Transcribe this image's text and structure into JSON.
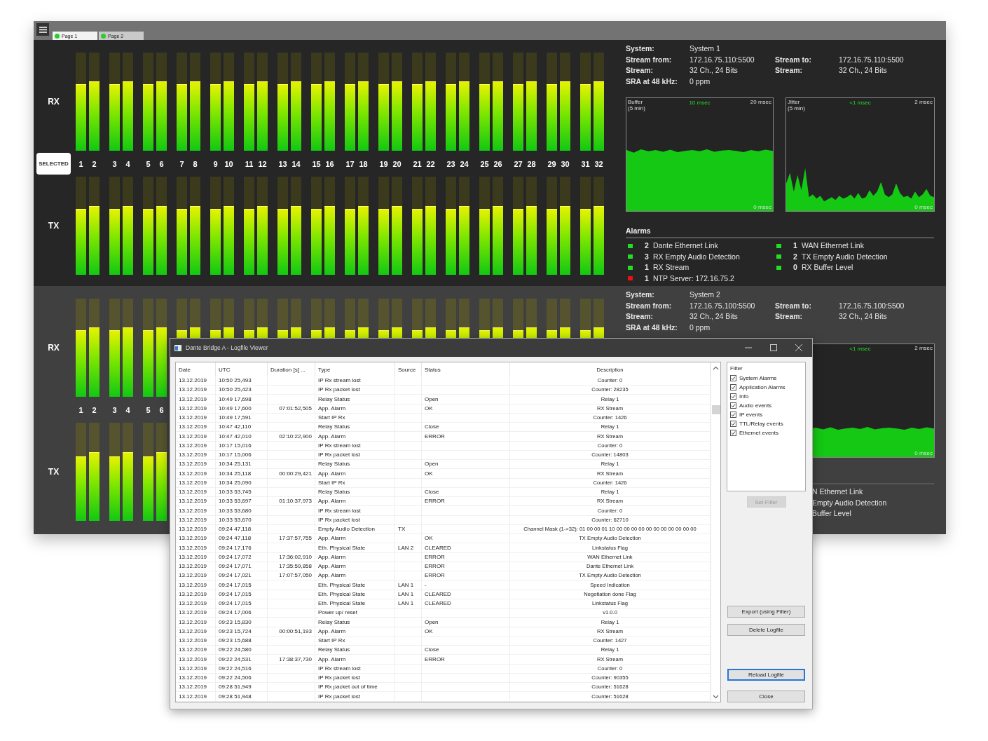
{
  "tabs": [
    {
      "label": "Page 1",
      "selected": true
    },
    {
      "label": "Page 2",
      "selected": false
    }
  ],
  "systems": [
    {
      "selected": true,
      "kind": "full",
      "selected_label": "SELECTED",
      "rx_label": "RX",
      "tx_label": "TX",
      "channel_labels": [
        "1",
        "2",
        "3",
        "4",
        "5",
        "6",
        "7",
        "8",
        "9",
        "10",
        "11",
        "12",
        "13",
        "14",
        "15",
        "16",
        "17",
        "18",
        "19",
        "20",
        "21",
        "22",
        "23",
        "24",
        "25",
        "26",
        "27",
        "28",
        "29",
        "30",
        "31",
        "32"
      ],
      "rx_meters": [
        {
          "level": 0.68
        },
        {
          "level": 0.71
        },
        {
          "level": 0.68
        },
        {
          "level": 0.71
        },
        {
          "level": 0.68
        },
        {
          "level": 0.71
        },
        {
          "level": 0.68
        },
        {
          "level": 0.71
        },
        {
          "level": 0.68
        },
        {
          "level": 0.71
        },
        {
          "level": 0.68
        },
        {
          "level": 0.71
        },
        {
          "level": 0.68
        },
        {
          "level": 0.71
        },
        {
          "level": 0.68
        },
        {
          "level": 0.71
        },
        {
          "level": 0.68
        },
        {
          "level": 0.71
        },
        {
          "level": 0.68
        },
        {
          "level": 0.71
        },
        {
          "level": 0.68
        },
        {
          "level": 0.71
        },
        {
          "level": 0.68
        },
        {
          "level": 0.71
        },
        {
          "level": 0.68
        },
        {
          "level": 0.71
        },
        {
          "level": 0.68
        },
        {
          "level": 0.71
        },
        {
          "level": 0.68
        },
        {
          "level": 0.71
        },
        {
          "level": 0.68
        },
        {
          "level": 0.71
        }
      ],
      "tx_meters": [
        {
          "level": 0.67
        },
        {
          "level": 0.7
        },
        {
          "level": 0.67
        },
        {
          "level": 0.7
        },
        {
          "level": 0.67
        },
        {
          "level": 0.7
        },
        {
          "level": 0.67
        },
        {
          "level": 0.7
        },
        {
          "level": 0.67
        },
        {
          "level": 0.7
        },
        {
          "level": 0.67
        },
        {
          "level": 0.7
        },
        {
          "level": 0.67
        },
        {
          "level": 0.7
        },
        {
          "level": 0.67
        },
        {
          "level": 0.7
        },
        {
          "level": 0.67
        },
        {
          "level": 0.7
        },
        {
          "level": 0.67
        },
        {
          "level": 0.7
        },
        {
          "level": 0.67
        },
        {
          "level": 0.7
        },
        {
          "level": 0.67
        },
        {
          "level": 0.7
        },
        {
          "level": 0.67
        },
        {
          "level": 0.7
        },
        {
          "level": 0.67
        },
        {
          "level": 0.7
        },
        {
          "level": 0.67
        },
        {
          "level": 0.7
        },
        {
          "level": 0.67
        },
        {
          "level": 0.7
        }
      ],
      "info_left": [
        {
          "label": "System:",
          "value": "System 1"
        },
        {
          "label": "Stream from:",
          "value": "172.16.75.110:5500"
        },
        {
          "label": "Stream:",
          "value": "32 Ch., 24 Bits"
        },
        {
          "label": "SRA at 48 kHz:",
          "value": "0 ppm"
        }
      ],
      "info_right": [
        {
          "label": "Stream to:",
          "value": "172.16.75.110:5500"
        },
        {
          "label": "Stream:",
          "value": "32 Ch., 24 Bits"
        }
      ],
      "graphs": [
        {
          "kind": "plateau",
          "title": "Buffer",
          "subtitle": "(5 min)",
          "current": "10 msec",
          "max": "20 msec",
          "min": "0 msec"
        },
        {
          "kind": "spikes",
          "title": "Jitter",
          "subtitle": "(5 min)",
          "current": "<1 msec",
          "max": "2 msec",
          "min": "0 msec"
        }
      ],
      "alarms_title": "Alarms",
      "alarms": [
        {
          "count": "2",
          "label": "Dante Ethernet Link",
          "color": "#22dd22"
        },
        {
          "count": "1",
          "label": "WAN Ethernet Link",
          "color": "#22dd22"
        },
        {
          "count": "3",
          "label": "RX Empty Audio Detection",
          "color": "#22dd22"
        },
        {
          "count": "2",
          "label": "TX Empty Audio Detection",
          "color": "#22dd22"
        },
        {
          "count": "1",
          "label": "RX Stream",
          "color": "#22dd22"
        },
        {
          "count": "0",
          "label": "RX Buffer Level",
          "color": "#22dd22"
        },
        {
          "count": "1",
          "label": "NTP Server: 172.16.75.2",
          "color": "#ee1111"
        }
      ]
    },
    {
      "selected": false,
      "kind": "covered",
      "rx_label": "RX",
      "tx_label": "TX",
      "channel_labels": [
        "1",
        "2",
        "3",
        "4",
        "5",
        "6"
      ],
      "rx_meters": [
        {
          "level": 0.68
        },
        {
          "level": 0.71
        },
        {
          "level": 0.68
        },
        {
          "level": 0.71
        },
        {
          "level": 0.68
        },
        {
          "level": 0.71
        },
        {
          "level": 0.68
        },
        {
          "level": 0.71
        },
        {
          "level": 0.68
        },
        {
          "level": 0.71
        },
        {
          "level": 0.68
        },
        {
          "level": 0.71
        },
        {
          "level": 0.68
        },
        {
          "level": 0.71
        },
        {
          "level": 0.68
        },
        {
          "level": 0.71
        },
        {
          "level": 0.68
        },
        {
          "level": 0.71
        },
        {
          "level": 0.68
        },
        {
          "level": 0.71
        },
        {
          "level": 0.68
        },
        {
          "level": 0.71
        },
        {
          "level": 0.68
        },
        {
          "level": 0.71
        },
        {
          "level": 0.68
        },
        {
          "level": 0.71
        },
        {
          "level": 0.68
        },
        {
          "level": 0.71
        },
        {
          "level": 0.68
        },
        {
          "level": 0.71
        },
        {
          "level": 0.68
        },
        {
          "level": 0.71
        }
      ],
      "tx_meters": [
        {
          "level": 0.66
        },
        {
          "level": 0.7
        },
        {
          "level": 0.66
        },
        {
          "level": 0.7
        },
        {
          "level": 0.66
        },
        {
          "level": 0.7
        }
      ],
      "info_left": [
        {
          "label": "System:",
          "value": "System 2"
        },
        {
          "label": "Stream from:",
          "value": "172.16.75.100:5500"
        },
        {
          "label": "Stream:",
          "value": "32 Ch., 24 Bits"
        },
        {
          "label": "SRA at 48 kHz:",
          "value": "0 ppm"
        }
      ],
      "info_right": [
        {
          "label": "Stream to:",
          "value": "172.16.75.100:5500"
        },
        {
          "label": "Stream:",
          "value": "32 Ch., 24 Bits"
        }
      ],
      "graphs": [
        {
          "kind": "band",
          "current": "<1 msec",
          "max": "2 msec",
          "min": "0 msec"
        }
      ],
      "alarms": [
        {
          "label": "N Ethernet Link"
        },
        {
          "label": "Empty Audio Detection"
        },
        {
          "label": "Buffer Level"
        }
      ]
    }
  ],
  "logfile_viewer": {
    "title": "Dante Bridge A - Logfile Viewer",
    "columns": [
      "Date",
      "UTC",
      "Duration [s] ...",
      "Type",
      "Source",
      "Status",
      "Description"
    ],
    "rows": [
      {
        "date": "13.12.2019",
        "utc": "10:50 25,493",
        "type": "IP Rx stream lost",
        "description": "Counter: 0"
      },
      {
        "date": "13.12.2019",
        "utc": "10:50 25,423",
        "type": "IP Rx packet lost",
        "description": "Counter: 28235"
      },
      {
        "date": "13.12.2019",
        "utc": "10:49 17,698",
        "type": "Relay Status",
        "status": "Open",
        "description": "Relay 1"
      },
      {
        "date": "13.12.2019",
        "utc": "10:49 17,600",
        "duration": "07:01:52,505",
        "type": "App. Alarm",
        "status": "OK",
        "description": "RX Stream"
      },
      {
        "date": "13.12.2019",
        "utc": "10:49 17,591",
        "type": "Start IP Rx",
        "description": "Counter: 1426"
      },
      {
        "date": "13.12.2019",
        "utc": "10:47 42,110",
        "type": "Relay Status",
        "status": "Close",
        "description": "Relay 1"
      },
      {
        "date": "13.12.2019",
        "utc": "10:47 42,010",
        "duration": "02:10:22,900",
        "type": "App. Alarm",
        "status": "ERROR",
        "description": "RX Stream"
      },
      {
        "date": "13.12.2019",
        "utc": "10:17 15,016",
        "type": "IP Rx stream lost",
        "description": "Counter: 0"
      },
      {
        "date": "13.12.2019",
        "utc": "10:17 15,006",
        "type": "IP Rx packet lost",
        "description": "Counter: 14803"
      },
      {
        "date": "13.12.2019",
        "utc": "10:34 25,131",
        "type": "Relay Status",
        "status": "Open",
        "description": "Relay 1"
      },
      {
        "date": "13.12.2019",
        "utc": "10:34 25,118",
        "duration": "00:00:29,421",
        "type": "App. Alarm",
        "status": "OK",
        "description": "RX Stream"
      },
      {
        "date": "13.12.2019",
        "utc": "10:34 25,090",
        "type": "Start IP Rx",
        "description": "Counter: 1426"
      },
      {
        "date": "13.12.2019",
        "utc": "10:33 53,745",
        "type": "Relay Status",
        "status": "Close",
        "description": "Relay 1"
      },
      {
        "date": "13.12.2019",
        "utc": "10:33 53,697",
        "duration": "01:10:37,973",
        "type": "App. Alarm",
        "status": "ERROR",
        "description": "RX Stream"
      },
      {
        "date": "13.12.2019",
        "utc": "10:33 53,680",
        "type": "IP Rx stream lost",
        "description": "Counter: 0"
      },
      {
        "date": "13.12.2019",
        "utc": "10:33 53,670",
        "type": "IP Rx packet lost",
        "description": "Counter: 62710"
      },
      {
        "date": "13.12.2019",
        "utc": "09:24 47,118",
        "type": "Empty Audio Detection",
        "source": "TX",
        "description": "Channel Mask (1->32): 01 00 00 01 10 00 00 00 00 00 00 00 00 00 00 00"
      },
      {
        "date": "13.12.2019",
        "utc": "09:24 47,118",
        "duration": "17:37:57,755",
        "type": "App. Alarm",
        "status": "OK",
        "description": "TX Empty Audio Detection"
      },
      {
        "date": "13.12.2019",
        "utc": "09:24 17,176",
        "type": "Eth. Physical State",
        "source": "LAN 2",
        "status": "CLEARED",
        "description": "Linkstatus Flag"
      },
      {
        "date": "13.12.2019",
        "utc": "09:24 17,072",
        "duration": "17:36:02,910",
        "type": "App. Alarm",
        "status": "ERROR",
        "description": "WAN Ethernet Link"
      },
      {
        "date": "13.12.2019",
        "utc": "09:24 17,071",
        "duration": "17:35:59,858",
        "type": "App. Alarm",
        "status": "ERROR",
        "description": "Dante Ethernet Link"
      },
      {
        "date": "13.12.2019",
        "utc": "09:24 17,021",
        "duration": "17:07:57,050",
        "type": "App. Alarm",
        "status": "ERROR",
        "description": "TX Empty Audio Detection"
      },
      {
        "date": "13.12.2019",
        "utc": "09:24 17,015",
        "type": "Eth. Physical State",
        "source": "LAN 1",
        "status": "-",
        "description": "Speed Indication"
      },
      {
        "date": "13.12.2019",
        "utc": "09:24 17,015",
        "type": "Eth. Physical State",
        "source": "LAN 1",
        "status": "CLEARED",
        "description": "Negotiation done Flag"
      },
      {
        "date": "13.12.2019",
        "utc": "09:24 17,015",
        "type": "Eth. Physical State",
        "source": "LAN 1",
        "status": "CLEARED",
        "description": "Linkstatus Flag"
      },
      {
        "date": "13.12.2019",
        "utc": "09:24 17,006",
        "type": "Power up/ reset",
        "description": "v1.0.0"
      },
      {
        "date": "13.12.2019",
        "utc": "09:23 15,830",
        "type": "Relay Status",
        "status": "Open",
        "description": "Relay 1"
      },
      {
        "date": "13.12.2019",
        "utc": "09:23 15,724",
        "duration": "00:00:51,193",
        "type": "App. Alarm",
        "status": "OK",
        "description": "RX Stream"
      },
      {
        "date": "13.12.2019",
        "utc": "09:23 15,688",
        "type": "Start IP Rx",
        "description": "Counter: 1427"
      },
      {
        "date": "13.12.2019",
        "utc": "09:22 24,580",
        "type": "Relay Status",
        "status": "Close",
        "description": "Relay 1"
      },
      {
        "date": "13.12.2019",
        "utc": "09:22 24,531",
        "duration": "17:38:37,730",
        "type": "App. Alarm",
        "status": "ERROR",
        "description": "RX Stream"
      },
      {
        "date": "13.12.2019",
        "utc": "09:22 24,516",
        "type": "IP Rx stream lost",
        "description": "Counter: 0"
      },
      {
        "date": "13.12.2019",
        "utc": "09:22 24,506",
        "type": "IP Rx packet lost",
        "description": "Counter: 90355"
      },
      {
        "date": "13.12.2019",
        "utc": "09:28 51,949",
        "type": "IP Rx packet out of time",
        "description": "Counter: 51628"
      },
      {
        "date": "13.12.2019",
        "utc": "09:28 51,948",
        "type": "IP Rx packet lost",
        "description": "Counter: 51628"
      }
    ],
    "filter": {
      "title": "Filter",
      "items": [
        {
          "label": "System Alarms",
          "checked": true
        },
        {
          "label": "Application Alarms",
          "checked": true
        },
        {
          "label": "Info",
          "checked": true
        },
        {
          "label": "Audio events",
          "checked": true
        },
        {
          "label": "IP events",
          "checked": true
        },
        {
          "label": "TTL/Relay events",
          "checked": true
        },
        {
          "label": "Ethernet events",
          "checked": true
        }
      ]
    },
    "buttons": [
      {
        "label": "Set Filter",
        "disabled": true,
        "focused": false
      },
      {
        "label": "Export (using Filter)",
        "disabled": false,
        "focused": false
      },
      {
        "label": "Delete Logfile",
        "disabled": false,
        "focused": false
      },
      {
        "label": "Reload Logfile",
        "disabled": false,
        "focused": true
      },
      {
        "label": "Close",
        "disabled": false,
        "focused": false
      }
    ]
  }
}
